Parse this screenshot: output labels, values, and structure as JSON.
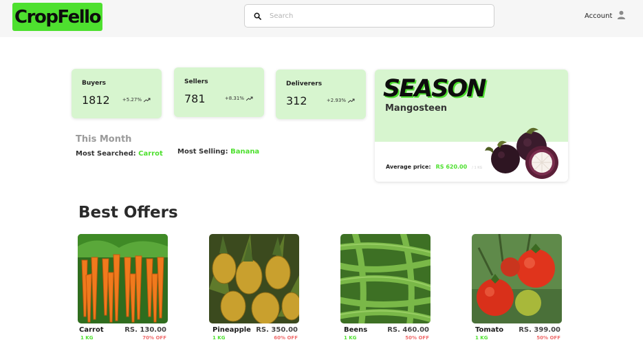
{
  "header": {
    "logo_text": "CropFello",
    "search_placeholder": "Search",
    "account_label": "Account"
  },
  "stats": [
    {
      "label": "Buyers",
      "value": "1812",
      "change": "+5.27%"
    },
    {
      "label": "Sellers",
      "value": "781",
      "change": "+8.31%"
    },
    {
      "label": "Deliverers",
      "value": "312",
      "change": "+2.93%"
    }
  ],
  "this_month": {
    "title": "This Month",
    "most_searched_label": "Most Searched:",
    "most_searched_value": "Carrot",
    "most_selling_label": "Most Selling:",
    "most_selling_value": "Banana"
  },
  "season": {
    "title": "SEASON",
    "fruit": "Mangosteen",
    "price_label": "Average price:",
    "price_value": "RS 620.00",
    "unit": "/ 1 KG"
  },
  "offers": {
    "title": "Best Offers",
    "items": [
      {
        "name": "Carrot",
        "price": "RS. 130.00",
        "qty": "1 KG",
        "discount": "70% OFF"
      },
      {
        "name": "Pineapple",
        "price": "RS. 350.00",
        "qty": "1 KG",
        "discount": "60% OFF"
      },
      {
        "name": "Beens",
        "price": "RS. 460.00",
        "qty": "1 KG",
        "discount": "50% OFF"
      },
      {
        "name": "Tomato",
        "price": "RS. 399.00",
        "qty": "1 KG",
        "discount": "50% OFF"
      }
    ]
  },
  "colors": {
    "brand_green": "#4ee02f",
    "card_green": "#d7f5cf",
    "discount_red": "#ef6c6c"
  }
}
